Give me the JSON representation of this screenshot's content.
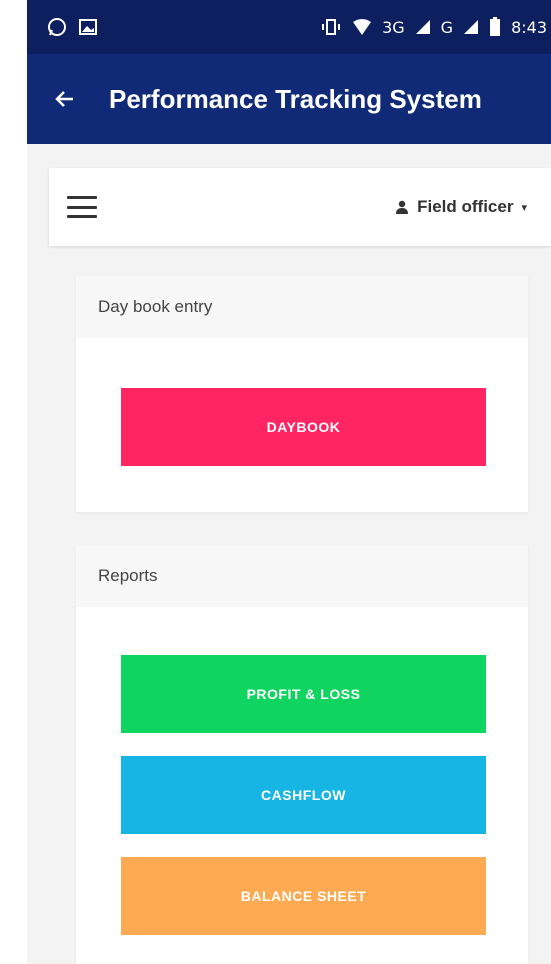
{
  "status_bar": {
    "time": "8:43",
    "network_label": "3G",
    "network_labels": [
      "G",
      "G"
    ],
    "icons": [
      "whatsapp-icon",
      "image-notification-icon",
      "vibrate-icon",
      "wifi-icon",
      "signal-icon",
      "signal-icon",
      "battery-icon"
    ]
  },
  "app_bar": {
    "title": "Performance Tracking System",
    "back_icon": "arrow-left-icon"
  },
  "toolbar": {
    "menu_icon": "hamburger-menu-icon",
    "user_icon": "person-icon",
    "user_label": "Field officer",
    "caret_icon": "caret-down-icon"
  },
  "daybook_card": {
    "title": "Day book entry",
    "buttons": [
      {
        "label": "DAYBOOK",
        "color": "#ff2462"
      }
    ]
  },
  "reports_card": {
    "title": "Reports",
    "buttons": [
      {
        "label": "PROFIT & LOSS",
        "color": "#0fd45f"
      },
      {
        "label": "CASHFLOW",
        "color": "#17b5e3"
      },
      {
        "label": "BALANCE SHEET",
        "color": "#fdaa53"
      }
    ]
  },
  "colors": {
    "status_bar": "#0d1f5e",
    "app_bar": "#112a78",
    "background": "#f3f3f3"
  }
}
